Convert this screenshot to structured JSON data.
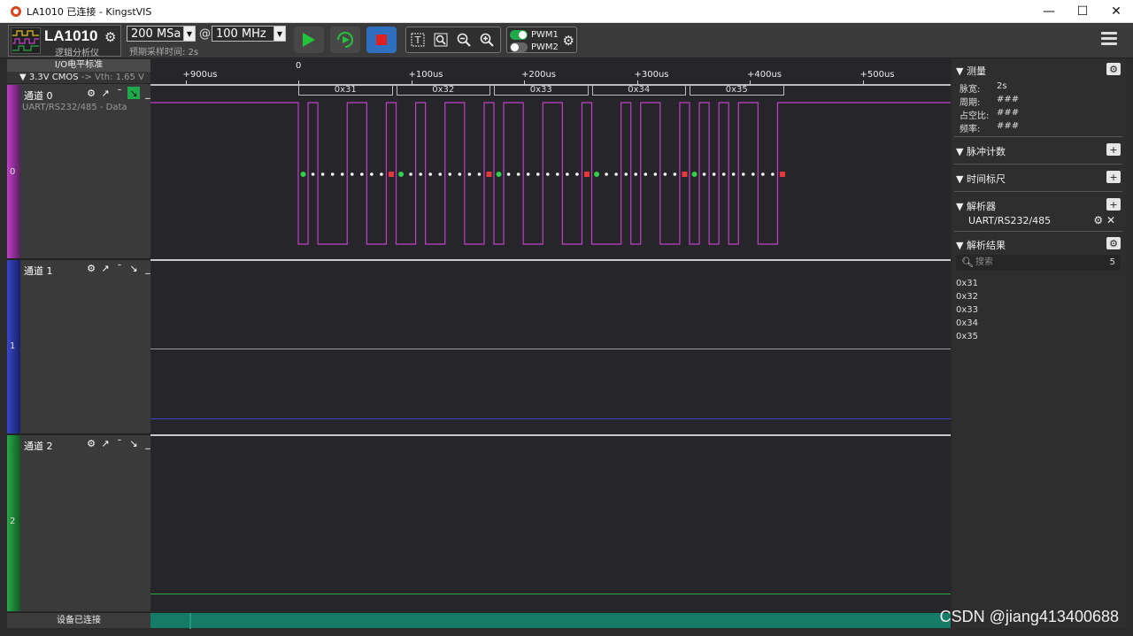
{
  "window": {
    "title": "LA1010 已连接 - KingstVIS",
    "minimize": "—",
    "maximize": "☐",
    "close": "✕"
  },
  "toolbar": {
    "device_name": "LA1010",
    "device_sub": "逻辑分析仪",
    "samples": "200 MSa",
    "at": "@",
    "rate": "100 MHz",
    "sample_time": "预期采样时间: 2s",
    "pwm1": "PWM1",
    "pwm2": "PWM2"
  },
  "io": {
    "header": "I/O电平标准",
    "standard": "3.3V CMOS",
    "vth": "-> Vth: 1.65 V"
  },
  "channels": [
    {
      "name": "通道 0",
      "num": "0",
      "desc": "UART/RS232/485 - Data",
      "color": "#c040c8"
    },
    {
      "name": "通道 1",
      "num": "1",
      "desc": "",
      "color": "#3a48c8"
    },
    {
      "name": "通道 2",
      "num": "2",
      "desc": "",
      "color": "#2aa84a"
    }
  ],
  "ruler": {
    "ticks": [
      {
        "label": "+900us",
        "t": -100
      },
      {
        "label": "0",
        "t": 0
      },
      {
        "label": "+100us",
        "t": 100
      },
      {
        "label": "+200us",
        "t": 200
      },
      {
        "label": "+300us",
        "t": 300
      },
      {
        "label": "+400us",
        "t": 400
      },
      {
        "label": "+500us",
        "t": 500
      }
    ]
  },
  "decoded": [
    "0x31",
    "0x32",
    "0x33",
    "0x34",
    "0x35"
  ],
  "status": {
    "left": "设备已连接"
  },
  "panel": {
    "measure": {
      "title": "测量",
      "width_label": "脉宽:",
      "width": "2s",
      "period_label": "周期:",
      "period": "###",
      "duty_label": "占空比:",
      "duty": "###",
      "freq_label": "频率:",
      "freq": "###"
    },
    "pulse_count": "脉冲计数",
    "time_ruler": "时间标尺",
    "analyzer": "解析器",
    "decoder": "UART/RS232/485",
    "results": "解析结果",
    "search_placeholder": "搜索",
    "result_count": "5"
  },
  "watermark": "CSDN @jiang413400688"
}
